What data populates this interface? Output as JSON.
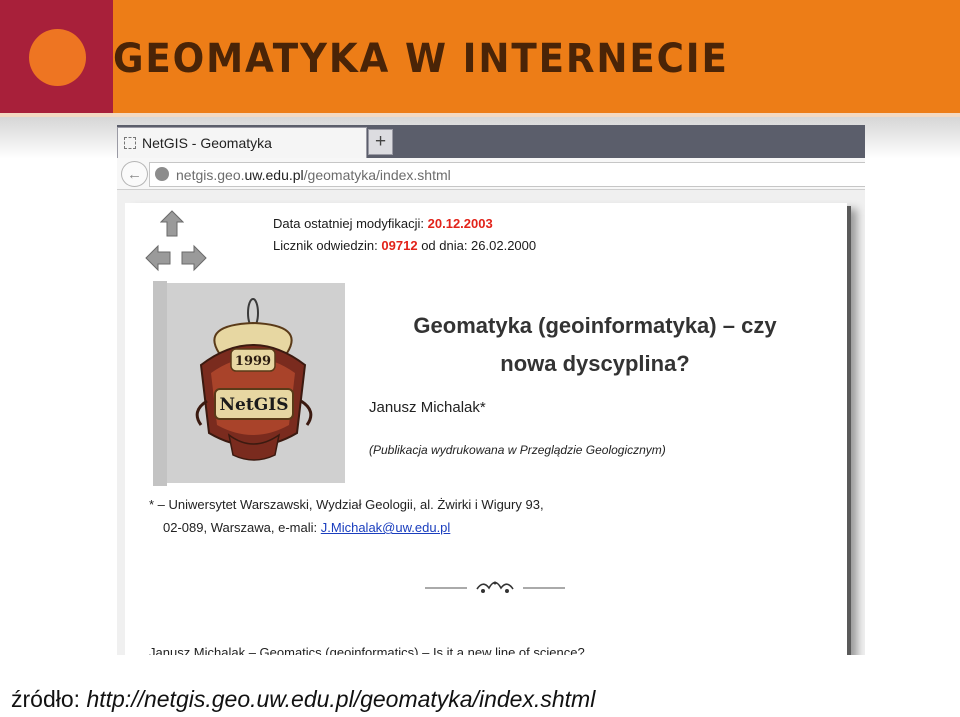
{
  "slide": {
    "title": "GEOMATYKA W INTERNECIE",
    "caption_label": "źródło:",
    "caption_url": "http://netgis.geo.uw.edu.pl/geomatyka/index.shtml",
    "colors": {
      "accent_red": "#a8203a",
      "accent_orange": "#ed7d17",
      "circle": "#ee7522"
    }
  },
  "browser": {
    "tab_title": "NetGIS - Geomatyka",
    "new_tab_label": "+",
    "url_prefix": "netgis.geo.",
    "url_domain": "uw.edu.pl",
    "url_path": "/geomatyka/index.shtml"
  },
  "page": {
    "modified_label": "Data ostatniej modyfikacji:",
    "modified_date": "20.12.2003",
    "counter_label": "Licznik odwiedzin:",
    "counter_value": "09712",
    "counter_since": "od dnia: 26.02.2000",
    "logo_year": "1999",
    "logo_text": "NetGIS",
    "title_line1": "Geomatyka (geoinformatyka) – czy",
    "title_line2": "nowa dyscyplina?",
    "author": "Janusz Michalak*",
    "publication_note": "(Publikacja wydrukowana w Przeglądzie Geologicznym)",
    "affiliation_line1": "* – Uniwersytet Warszawski, Wydział Geologii, al. Żwirki i Wigury 93,",
    "affiliation_line2": "02-089, Warszawa, e-mali:",
    "email": "J.Michalak@uw.edu.pl",
    "english_title": "Janusz Michalak – Geomatics (geoinformatics) – Is it a new line of science?"
  }
}
